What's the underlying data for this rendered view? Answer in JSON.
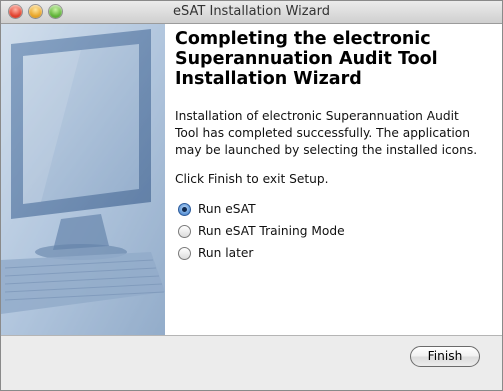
{
  "window": {
    "title": "eSAT Installation Wizard"
  },
  "heading": {
    "lines": [
      "Completing the electronic",
      "Superannuation Audit Tool",
      "Installation Wizard"
    ]
  },
  "description": {
    "lines": [
      "Installation of electronic Superannuation Audit",
      "Tool has completed successfully. The application",
      "may be launched by selecting the installed icons."
    ]
  },
  "instruction": "Click Finish to exit Setup.",
  "options": [
    {
      "label": "Run eSAT",
      "selected": true
    },
    {
      "label": "Run eSAT Training Mode",
      "selected": false
    },
    {
      "label": "Run later",
      "selected": false
    }
  ],
  "buttons": {
    "finish": "Finish"
  },
  "colors": {
    "sidebar_blue": "#9bb3cf",
    "radio_selected": "#3d75c0"
  }
}
